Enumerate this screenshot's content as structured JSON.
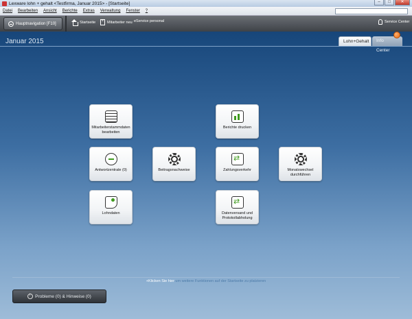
{
  "window": {
    "title": "Lexware lohn + gehalt <Testfirma, Januar 2015> - [Startseite]"
  },
  "menu": [
    "Datei",
    "Bearbeiten",
    "Ansicht",
    "Berichte",
    "Extras",
    "Verwaltung",
    "Fenster",
    "?"
  ],
  "toolbar": {
    "nav_label": "Hauptnavigation [F10]",
    "startseite": "Startseite",
    "mitarbeiter_neu": "Mitarbeiter neu",
    "eservice": "eService personal",
    "service_center": "Service Center"
  },
  "main": {
    "period": "Januar 2015",
    "tabs": [
      "Lohn+Gehalt",
      "Info Center"
    ]
  },
  "tiles": {
    "stammdaten": "Mitarbeiterstammdaten bearbeiten",
    "antwortzentrale": "Antwortzentrale (0)",
    "lohndaten": "Lohndaten",
    "beitragsnachweise": "Beitragsnachweise",
    "berichte": "Berichte drucken",
    "zahlungsverkehr": "Zahlungsverkehr",
    "datenversand": "Datenversand und Protokollabholung",
    "monatswechsel": "Monatswechsel durchführen"
  },
  "footer": {
    "hint_strong": "+Klicken Sie hier",
    "hint_rest": " um weitere Funktionen auf der Startseite zu platzieren",
    "problems": "Probleme (0) & Hinweise (0)"
  },
  "colors": {
    "accent_green": "#3f9a1e",
    "badge_orange": "#e86a10"
  }
}
